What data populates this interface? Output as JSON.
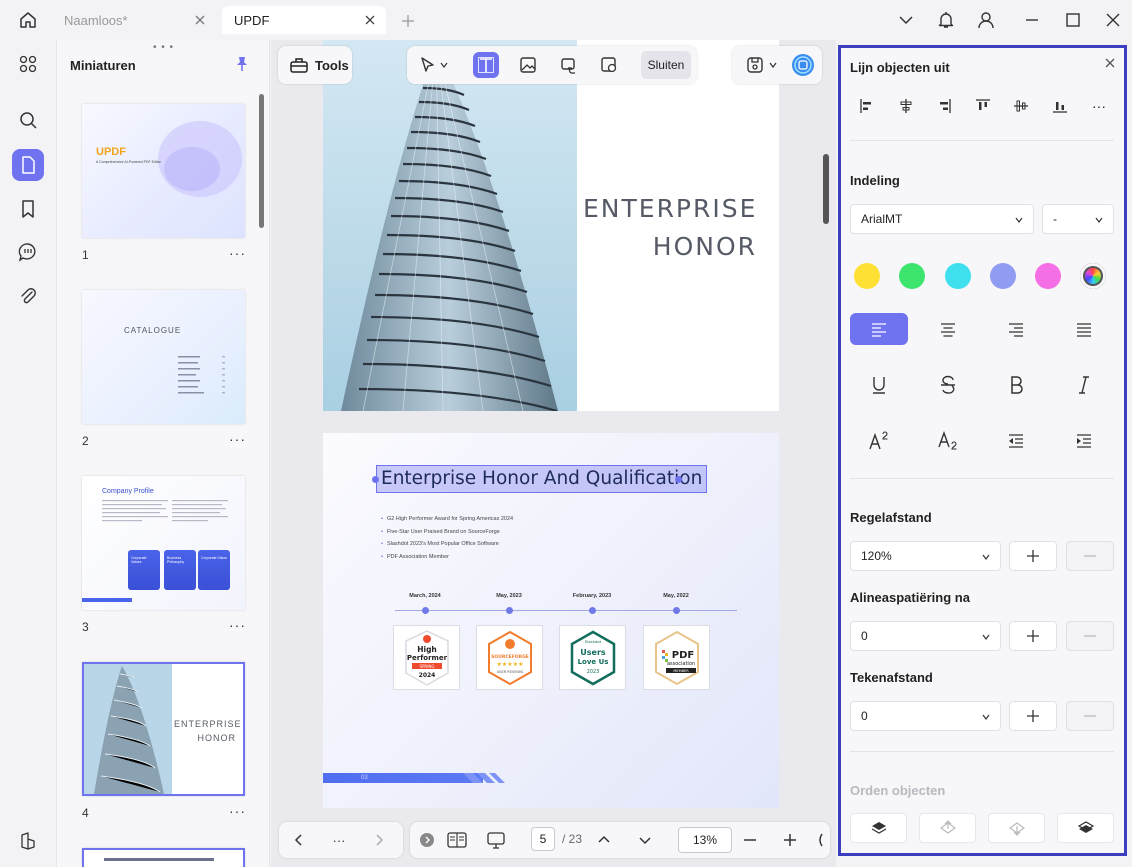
{
  "tabs": [
    {
      "label": "Naamloos*"
    },
    {
      "label": "UPDF"
    }
  ],
  "thumbnails": {
    "title": "Miniaturen",
    "more": "···",
    "pages": [
      {
        "number": "1",
        "brand": "UPDF",
        "subtitle": "A Comprehensive AI-Powered PDF Editor"
      },
      {
        "number": "2",
        "heading": "CATALOGUE"
      },
      {
        "number": "3",
        "heading": "Company Profile",
        "cards": [
          "Corporate Values",
          "Business Philosophy",
          "Corporate Vision"
        ]
      },
      {
        "number": "4",
        "line1": "ENTERPRISE",
        "line2": "HONOR"
      }
    ]
  },
  "toolbar": {
    "tools_label": "Tools",
    "close_label": "Sluiten"
  },
  "document": {
    "page1": {
      "line1": "ENTERPRISE",
      "line2": "HONOR"
    },
    "page2": {
      "title": "Enterprise Honor And Qualification",
      "bullets": [
        "G2 High Performer Award for Spring Americas 2024",
        "Five-Star User Praised Brand on SourceForge",
        "Slashdot 2023's Most Popular Office Software",
        "PDF Association Member"
      ],
      "timeline": [
        "March, 2024",
        "May, 2023",
        "February, 2023",
        "May, 2022"
      ],
      "badges": [
        {
          "name": "g2",
          "l1": "High",
          "l2": "Performer",
          "l3": "SPRING",
          "l4": "2024"
        },
        {
          "name": "sourceforge",
          "l1": "SOURCEFORGE",
          "l2": "★★★★★",
          "l3": "USER REVIEWS"
        },
        {
          "name": "slashdot",
          "l0": "Slashdot",
          "l1": "Users",
          "l2": "Love Us",
          "l3": "2023"
        },
        {
          "name": "pdf-association",
          "l1": "PDF",
          "l2": "association",
          "l3": "MEMBER"
        }
      ],
      "footer": "03"
    }
  },
  "pagination": {
    "more": "···",
    "current": "5",
    "total": "/ 23",
    "zoom": "13%"
  },
  "properties": {
    "align_title": "Lijn objecten uit",
    "more": "···",
    "format_title": "Indeling",
    "font": "ArialMT",
    "font_size": "-",
    "colors": [
      "#ffe135",
      "#3de56f",
      "#3ee0f0",
      "#8f9cf2",
      "#f46ee6"
    ],
    "line_spacing_title": "Regelafstand",
    "line_spacing": "120%",
    "para_spacing_title": "Alineaspatiëring na",
    "para_spacing": "0",
    "char_spacing_title": "Tekenafstand",
    "char_spacing": "0",
    "order_title": "Orden objecten"
  }
}
